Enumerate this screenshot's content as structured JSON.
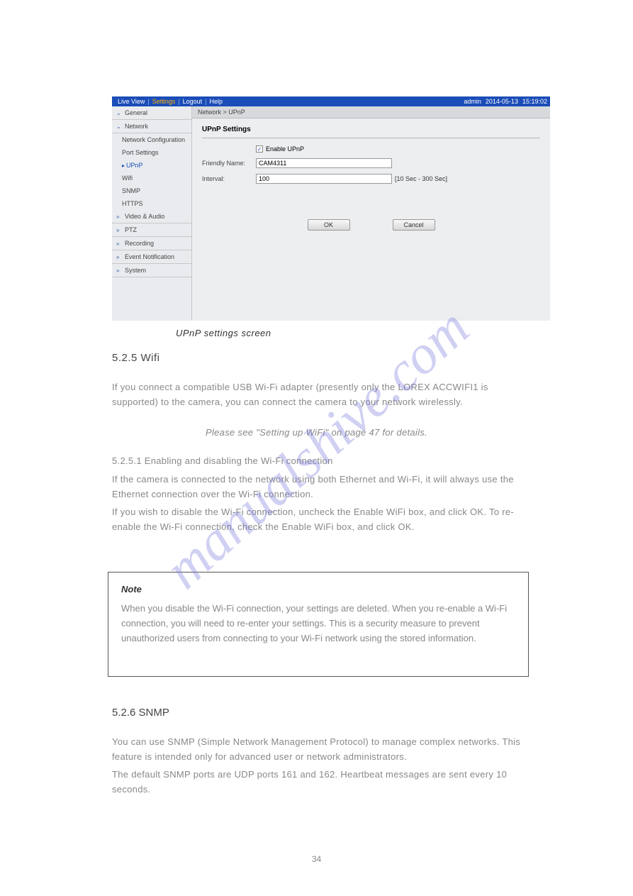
{
  "topnav": {
    "items": [
      "Live View",
      "Settings",
      "Logout",
      "Help"
    ],
    "active_index": 1,
    "user": "admin",
    "date": "2014-05-13",
    "time": "15:19:02"
  },
  "sidebar": {
    "general": "General",
    "network": "Network",
    "network_items": [
      "Network Configuration",
      "Port Settings",
      "UPnP",
      "Wifi",
      "SNMP",
      "HTTPS"
    ],
    "network_active": 2,
    "video_audio": "Video & Audio",
    "ptz": "PTZ",
    "recording": "Recording",
    "event": "Event Notification",
    "system": "System"
  },
  "breadcrumb": "Network > UPnP",
  "panel": {
    "title": "UPnP Settings",
    "enable_label": "Enable UPnP",
    "enable_checked": true,
    "friendly_label": "Friendly Name:",
    "friendly_value": "CAM4311",
    "interval_label": "Interval:",
    "interval_value": "100",
    "interval_hint": "[10 Sec - 300 Sec]",
    "ok": "OK",
    "cancel": "Cancel"
  },
  "caption": "UPnP settings screen",
  "heading_wifi": "5.2.5 Wifi",
  "para": {
    "p1": "If you connect a compatible USB Wi-Fi adapter (presently only the LOREX ACCWIFI1 is supported) to the camera, you can connect the camera to your network wirelessly.",
    "p2": "Please see \"Setting up WiFi\" on page 47 for details.",
    "p3": "5.2.5.1 Enabling and disabling the Wi-Fi connection",
    "p4": "If the camera is connected to the network using both Ethernet and Wi-Fi, it will always use the Ethernet connection over the Wi-Fi connection.",
    "p5": "If you wish to disable the Wi-Fi connection, uncheck the Enable WiFi box, and click OK. To re-enable the Wi-Fi connection, check the Enable WiFi box, and click OK."
  },
  "note": {
    "title": "Note",
    "body": "When you disable the Wi-Fi connection, your settings are deleted. When you re-enable a Wi-Fi connection, you will need to re-enter your settings. This is a security measure to prevent unauthorized users from connecting to your Wi-Fi network using the stored information."
  },
  "heading_snmp": "5.2.6 SNMP",
  "snmp": {
    "s1": "You can use SNMP (Simple Network Management Protocol) to manage complex networks. This feature is intended only for advanced user or network administrators.",
    "s2": "The default SNMP ports are UDP ports 161 and 162. Heartbeat messages are sent every 10 seconds."
  },
  "watermark": "manualshive.com",
  "page_number": "34"
}
